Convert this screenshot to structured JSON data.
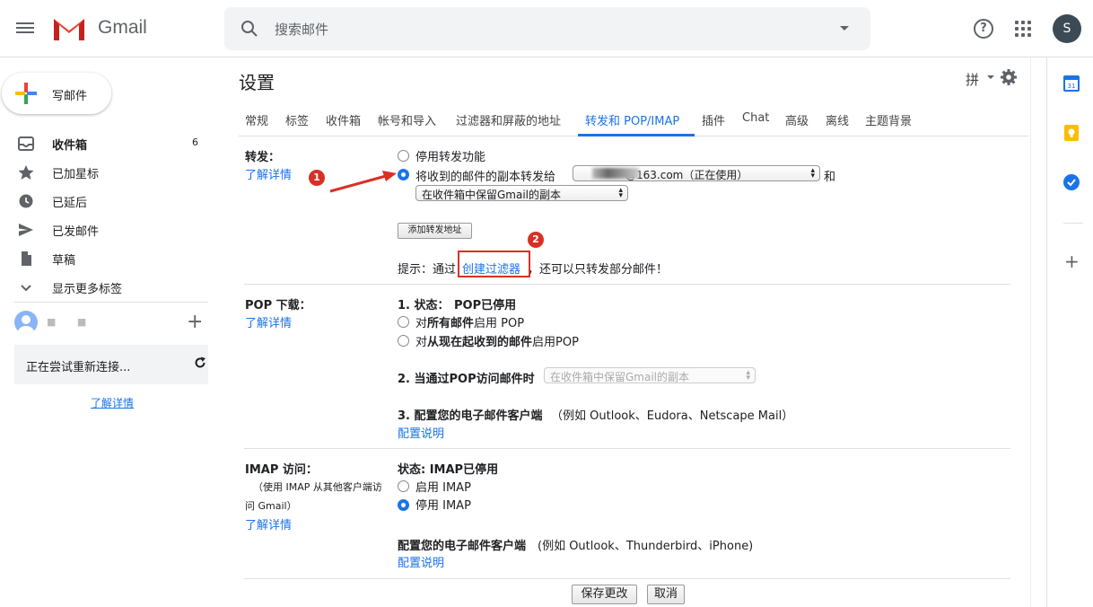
{
  "header": {
    "logo_text": "Gmail",
    "search_placeholder": "搜索邮件",
    "avatar_letter": "S"
  },
  "sidebar": {
    "compose_label": "写邮件",
    "items": [
      {
        "label": "收件箱",
        "count": "6",
        "icon": "inbox-icon"
      },
      {
        "label": "已加星标",
        "icon": "star-icon"
      },
      {
        "label": "已延后",
        "icon": "clock-icon"
      },
      {
        "label": "已发邮件",
        "icon": "send-icon"
      },
      {
        "label": "草稿",
        "icon": "draft-icon"
      },
      {
        "label": "显示更多标签",
        "icon": "chevron-down-icon"
      }
    ],
    "reconnect_text": "正在尝试重新连接...",
    "learn_more": "了解详情"
  },
  "main": {
    "title": "设置",
    "ime_label": "拼",
    "tabs": [
      "常规",
      "标签",
      "收件箱",
      "帐号和导入",
      "过滤器和屏蔽的地址",
      "转发和 POP/IMAP",
      "插件",
      "Chat",
      "高级",
      "离线",
      "主题背景"
    ],
    "active_tab": "转发和 POP/IMAP",
    "forwarding": {
      "label": "转发：",
      "learn_more": "了解详情",
      "disable_option": "停用转发功能",
      "forward_option": "将收到的邮件的副本转发给",
      "forward_address": "@163.com（正在使用）",
      "and_text": "和",
      "keep_option": "在收件箱中保留Gmail的副本",
      "add_button": "添加转发地址",
      "tip_prefix": "提示：通过",
      "tip_link": "创建过滤器",
      "tip_suffix": "，还可以只转发部分邮件！"
    },
    "pop": {
      "label": "POP 下载：",
      "learn_more": "了解详情",
      "status_prefix": "1. 状态：",
      "status_value": "POP已停用",
      "opt_all_pre": "对",
      "opt_all_bold": "所有邮件",
      "opt_all_post": "启用 POP",
      "opt_new_pre": "对",
      "opt_new_bold": "从现在起收到的邮件",
      "opt_new_post": "启用POP",
      "access_label": "2. 当通过POP访问邮件时",
      "access_select": "在收件箱中保留Gmail的副本",
      "config_label": "3. 配置您的电子邮件客户端",
      "config_hint": "（例如 Outlook、Eudora、Netscape Mail）",
      "config_link": "配置说明"
    },
    "imap": {
      "label": "IMAP 访问：",
      "sub1": "（使用 IMAP 从其他客户端访",
      "sub2": "问 Gmail）",
      "learn_more": "了解详情",
      "status": "状态: IMAP已停用",
      "enable": "启用 IMAP",
      "disable": "停用 IMAP",
      "config_label": "配置您的电子邮件客户端",
      "config_hint": " (例如 Outlook、Thunderbird、iPhone)",
      "config_link": "配置说明"
    },
    "save_button": "保存更改",
    "cancel_button": "取消"
  },
  "annotations": {
    "badge1": "1",
    "badge2": "2"
  },
  "colors": {
    "accent": "#1a73e8",
    "annotation": "#d93025"
  }
}
